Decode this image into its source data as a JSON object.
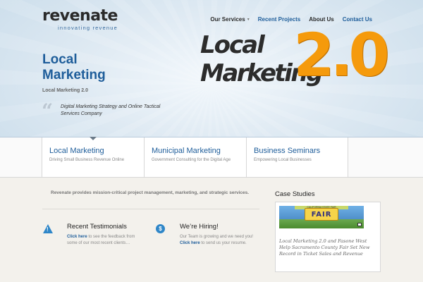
{
  "header": {
    "logo_word": "revenate",
    "logo_tagline": "innovating revenue",
    "nav": [
      {
        "label": "Our Services",
        "caret": "▾",
        "color": "#2a2a2a"
      },
      {
        "label": "Recent Projects",
        "color": "#1e5d9a"
      },
      {
        "label": "About Us",
        "color": "#2a2a2a"
      },
      {
        "label": "Contact Us",
        "color": "#1e5d9a"
      }
    ]
  },
  "hero": {
    "title_line1": "Local",
    "title_line2": "Marketing",
    "subtitle": "Local Marketing 2.0",
    "quote_mark": "“",
    "quote": "Digital Marketing Strategy and Online Tactical Services Company",
    "big_logo": {
      "line1": "Local",
      "line2": "Marketing",
      "number": "2.0"
    }
  },
  "features": [
    {
      "title": "Local Marketing",
      "desc": "Driving Small Business Revenue Online"
    },
    {
      "title": "Municipal Marketing",
      "desc": "Government Consulting for the Digital Age"
    },
    {
      "title": "Business Seminars",
      "desc": "Empowering Local Businesses"
    }
  ],
  "main": {
    "intro": "Revenate provides mission-critical project management, marketing, and strategic services.",
    "columns": [
      {
        "icon": "warning-icon",
        "icon_glyph": "!",
        "title": "Recent Testimonials",
        "link": "Click here",
        "text": " to see the feedback from some of our most recent clients…"
      },
      {
        "icon": "dollar-icon",
        "icon_glyph": "$",
        "title": "We’re Hiring!",
        "text_before": "Our Team is growing and we need you! ",
        "link": "Click here",
        "text": " to send us your resume."
      }
    ]
  },
  "sidebar": {
    "title": "Case Studies",
    "case": {
      "image_sign": "FAIR",
      "image_banner": "CALIFORNIA STATE FAIR",
      "text": "Local Marketing 2.0 and Fasone West Help Sacramento County Fair Set New Record in Ticket Sales and Revenue"
    }
  },
  "colors": {
    "accent": "#1e5d9a",
    "orange": "#f59a0c",
    "icon_blue": "#2e86c8"
  }
}
